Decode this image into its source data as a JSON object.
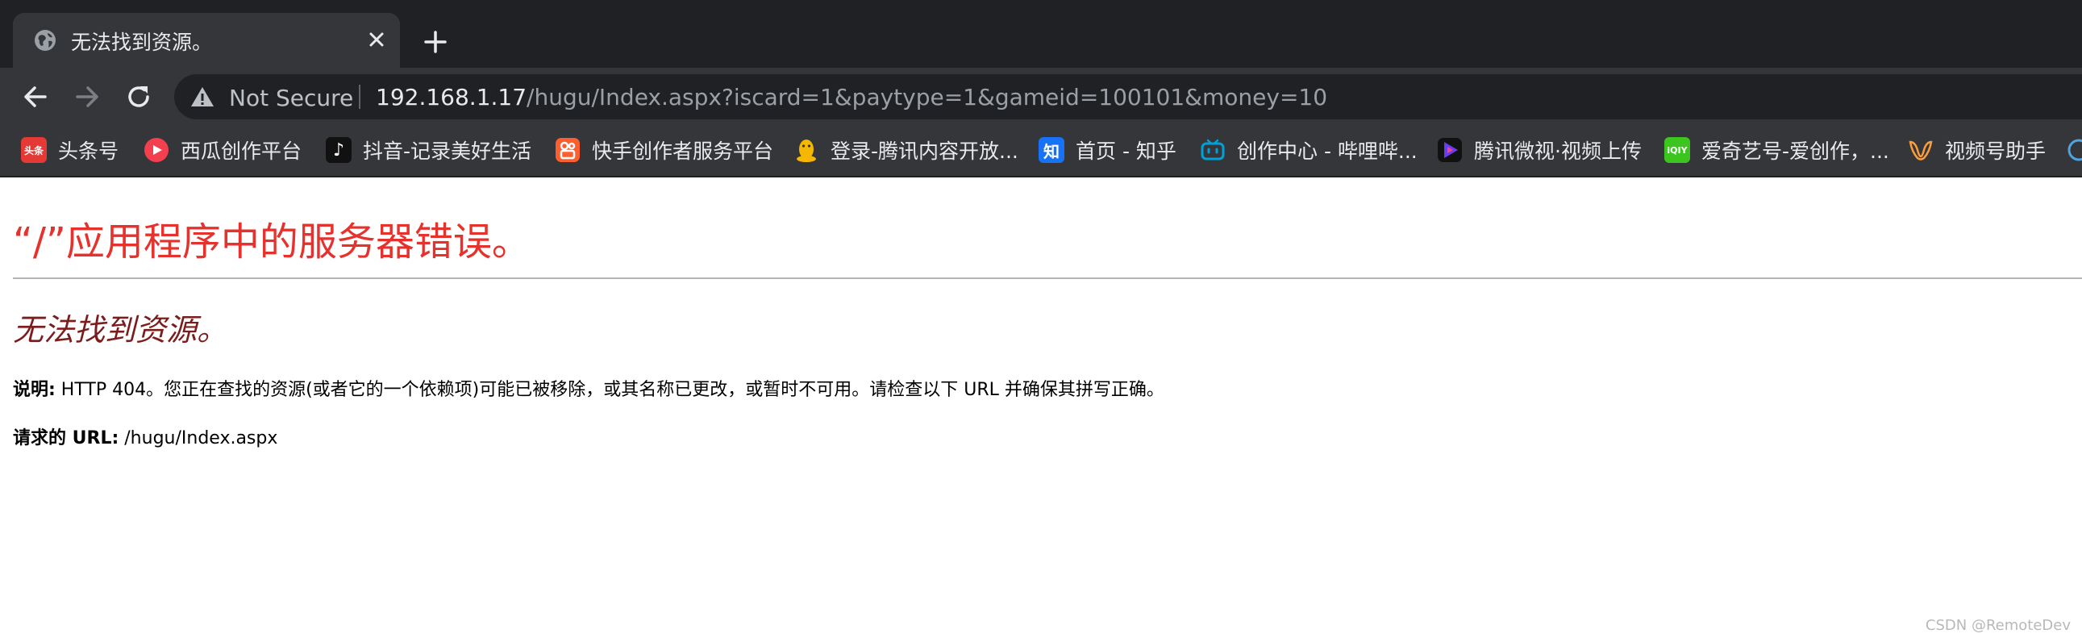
{
  "tab": {
    "title": "无法找到资源。",
    "favicon": "globe-icon",
    "close_icon": "close-icon",
    "new_tab_icon": "plus-icon"
  },
  "toolbar": {
    "back_icon": "arrow-left-icon",
    "forward_icon": "arrow-right-icon",
    "reload_icon": "reload-icon",
    "security_icon": "warning-triangle-icon",
    "security_label": "Not Secure",
    "url_host": "192.168.1.17",
    "url_path": "/hugu/Index.aspx?iscard=1&paytype=1&gameid=100101&money=10"
  },
  "bookmarks": [
    {
      "label": "头条号",
      "icon_text": "头条",
      "icon_color": "#e53935"
    },
    {
      "label": "西瓜创作平台",
      "icon_text": "",
      "icon_color": "#f43f4f"
    },
    {
      "label": "抖音-记录美好生活",
      "icon_text": "♪",
      "icon_color": "#111111"
    },
    {
      "label": "快手创作者服务平台",
      "icon_text": "",
      "icon_color": "#fe5e2f"
    },
    {
      "label": "登录-腾讯内容开放...",
      "icon_text": "",
      "icon_color": "#f5b700"
    },
    {
      "label": "首页 - 知乎",
      "icon_text": "知",
      "icon_color": "#1772f6"
    },
    {
      "label": "创作中心 - 哔哩哔...",
      "icon_text": "",
      "icon_color": "#00a1d6"
    },
    {
      "label": "腾讯微视·视频上传",
      "icon_text": "▶",
      "icon_color": "#6a3cf0"
    },
    {
      "label": "爱奇艺号-爱创作，...",
      "icon_text": "iQIY",
      "icon_color": "#3cc51f"
    },
    {
      "label": "视频号助手",
      "icon_text": "",
      "icon_color": "#fa9d3b"
    }
  ],
  "page": {
    "heading": "“/”应用程序中的服务器错误。",
    "subheading": "无法找到资源。",
    "desc_label": "说明:",
    "desc_text": " HTTP 404。您正在查找的资源(或者它的一个依赖项)可能已被移除，或其名称已更改，或暂时不可用。请检查以下 URL 并确保其拼写正确。",
    "url_label": "请求的 URL:",
    "url_value": " /hugu/Index.aspx",
    "watermark": "CSDN @RemoteDev"
  }
}
